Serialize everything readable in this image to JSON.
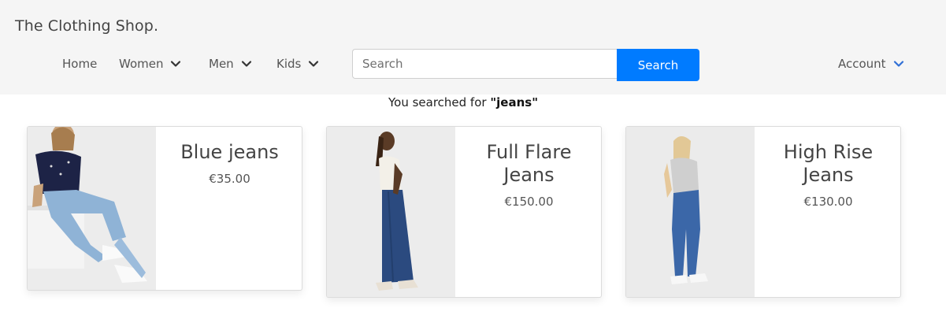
{
  "header": {
    "brand": "The Clothing Shop.",
    "nav": [
      {
        "label": "Home",
        "dropdown": false
      },
      {
        "label": "Women",
        "dropdown": true
      },
      {
        "label": "Men",
        "dropdown": true
      },
      {
        "label": "Kids",
        "dropdown": true
      }
    ],
    "search": {
      "placeholder": "Search",
      "value": "",
      "button_label": "Search"
    },
    "account_label": "Account"
  },
  "results": {
    "prefix": "You searched for ",
    "query": "\"jeans\""
  },
  "products": [
    {
      "title": "Blue jeans",
      "price": "€35.00",
      "image": "model-blue-jeans-photo"
    },
    {
      "title": "Full Flare Jeans",
      "price": "€150.00",
      "image": "model-flare-jeans-photo"
    },
    {
      "title": "High Rise Jeans",
      "price": "€130.00",
      "image": "model-high-rise-jeans-photo"
    }
  ],
  "colors": {
    "accent": "#007bff",
    "header_bg": "#f5f5f5",
    "text": "#444444"
  }
}
